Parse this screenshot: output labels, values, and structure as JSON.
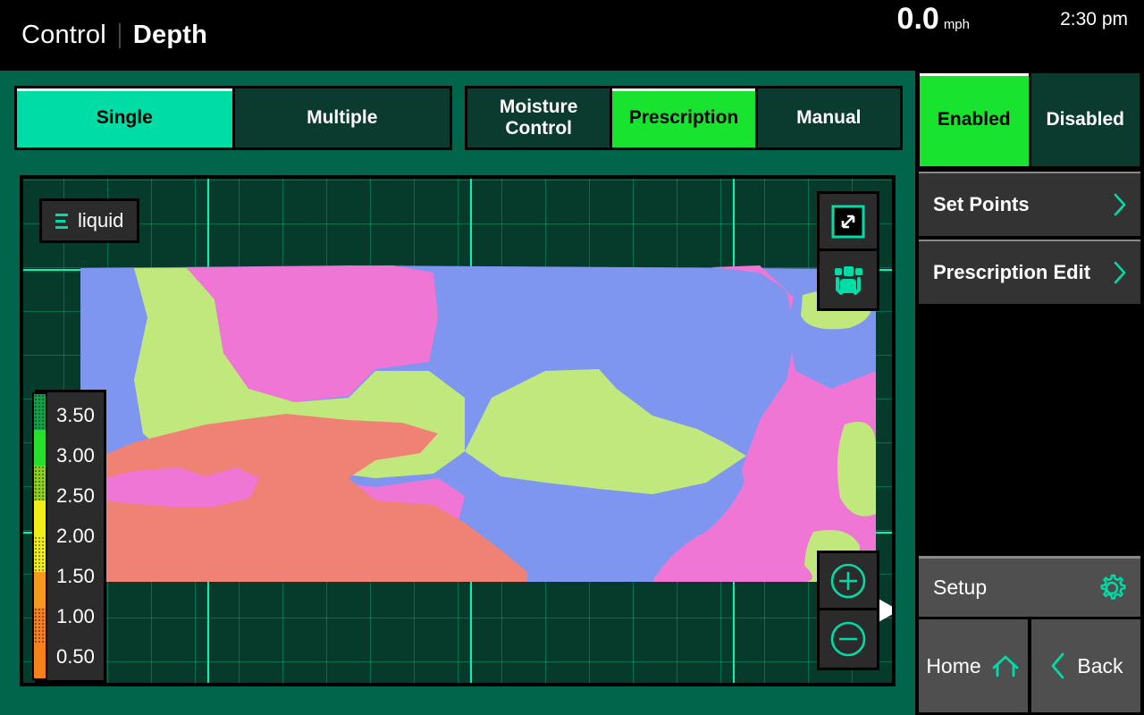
{
  "header": {
    "breadcrumb_parent": "Control",
    "breadcrumb_current": "Depth",
    "speed_value": "0.0",
    "speed_unit": "mph",
    "clock": "2:30 pm"
  },
  "mode_tabs": {
    "items": [
      {
        "label": "Single",
        "selected": true
      },
      {
        "label": "Multiple",
        "selected": false
      }
    ]
  },
  "control_tabs": {
    "items": [
      {
        "label": "Moisture\nControl",
        "selected": false
      },
      {
        "label": "Prescription",
        "selected": true
      },
      {
        "label": "Manual",
        "selected": false
      }
    ]
  },
  "map": {
    "layer_chip_label": "liquid",
    "controls": {
      "fullscreen_icon": "expand-arrows-icon",
      "vehicle_icon": "tractor-icon",
      "zoom_in_icon": "plus-circle-icon",
      "zoom_out_icon": "minus-circle-icon"
    },
    "vehicle_marker_icon": "vehicle-direction-triangle",
    "legend": {
      "values": [
        "3.50",
        "3.00",
        "2.50",
        "2.00",
        "1.50",
        "1.00",
        "0.50"
      ],
      "scale_colors": [
        "#13a04a",
        "#27e02c",
        "#8fd11c",
        "#f2ef18",
        "#f2ef18",
        "#f59a1c",
        "#f7821b",
        "#f7821b"
      ]
    },
    "zone_colors": {
      "pink": "#ef76d4",
      "green": "#c1e87c",
      "blue": "#7e96ef",
      "salmon": "#ef8274",
      "background": "#063a2b",
      "gridline": "#00ffbe"
    }
  },
  "sidebar": {
    "enable_toggle": [
      {
        "label": "Enabled",
        "selected": true
      },
      {
        "label": "Disabled",
        "selected": false
      }
    ],
    "menu_items": [
      {
        "label": "Set Points",
        "chevron": "chevron-right-icon"
      },
      {
        "label": "Prescription Edit",
        "chevron": "chevron-right-icon"
      }
    ],
    "setup": {
      "label": "Setup",
      "icon": "gear-icon"
    },
    "home": {
      "label": "Home",
      "icon": "home-icon"
    },
    "back": {
      "label": "Back",
      "icon": "chevron-left-icon"
    }
  },
  "theme": {
    "accent_teal": "#00dca5",
    "accent_green": "#18e430",
    "page_bg": "#00654a",
    "panel_dark": "#2b2b2b",
    "tab_unselected": "#0b3b2e"
  }
}
